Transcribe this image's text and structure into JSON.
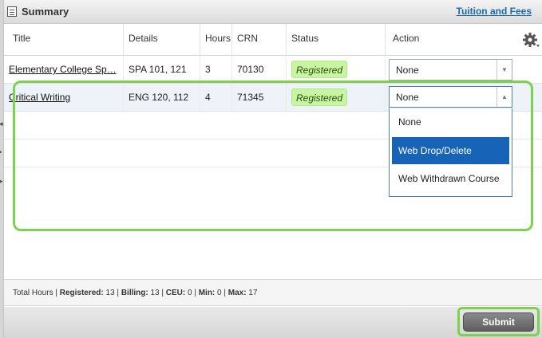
{
  "panel": {
    "title": "Summary",
    "tuition_link": "Tuition and Fees"
  },
  "columns": {
    "title": "Title",
    "details": "Details",
    "hours": "Hours",
    "crn": "CRN",
    "status": "Status",
    "action": "Action"
  },
  "rows": [
    {
      "title": "Elementary College Sp…",
      "details": "SPA 101, 121",
      "hours": "3",
      "crn": "70130",
      "status": "Registered",
      "action": "None"
    },
    {
      "title": "Critical Writing",
      "details": "ENG 120, 112",
      "hours": "4",
      "crn": "71345",
      "status": "Registered",
      "action": "None"
    }
  ],
  "dropdown": {
    "options": [
      "None",
      "Web Drop/Delete",
      "Web Withdrawn Course"
    ],
    "highlighted": "Web Drop/Delete"
  },
  "footer": {
    "total_hours_label": "Total Hours |",
    "registered_label": "Registered:",
    "registered_value": "13",
    "billing_label": "Billing:",
    "billing_value": "13",
    "ceu_label": "CEU:",
    "ceu_value": "0",
    "min_label": "Min:",
    "min_value": "0",
    "max_label": "Max:",
    "max_value": "17"
  },
  "buttons": {
    "submit": "Submit"
  },
  "colors": {
    "highlight_green": "#7bd34c",
    "registered_badge": "#c8f5a0",
    "selected_option": "#1763b8",
    "link_blue": "#1c6aa8"
  }
}
